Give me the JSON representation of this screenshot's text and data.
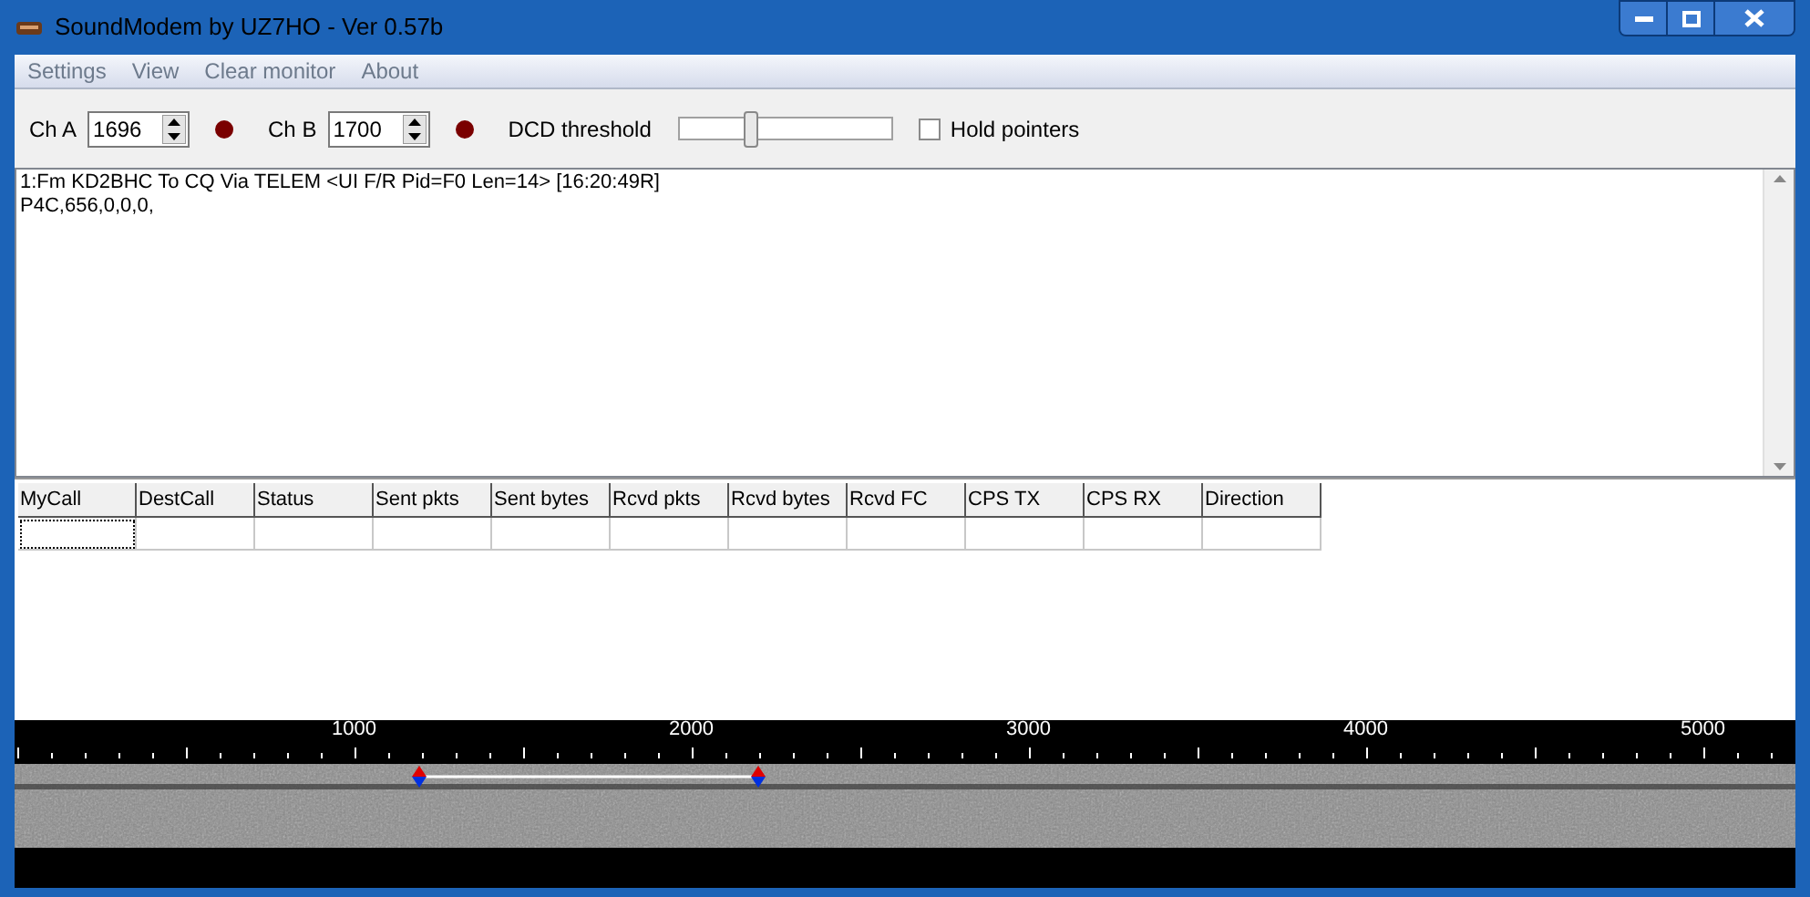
{
  "window": {
    "title": "SoundModem by UZ7HO - Ver 0.57b"
  },
  "menu": [
    "Settings",
    "View",
    "Clear monitor",
    "About"
  ],
  "toolbar": {
    "channels": [
      {
        "label": "Ch A",
        "value": "1696",
        "color": "#7a0000"
      },
      {
        "label": "Ch B",
        "value": "1700",
        "color": "#7a0000"
      }
    ],
    "dcd": {
      "label": "DCD threshold",
      "level": 0.32
    },
    "hold_pointers": {
      "label": "Hold pointers",
      "checked": false
    }
  },
  "monitor": {
    "lines": [
      "1:Fm KD2BHC To CQ Via TELEM <UI F/R Pid=F0 Len=14> [16:20:49R]",
      "P4C,656,0,0,0,"
    ]
  },
  "table": {
    "columns": [
      "MyCall",
      "DestCall",
      "Status",
      "Sent pkts",
      "Sent bytes",
      "Rcvd pkts",
      "Rcvd bytes",
      "Rcvd FC",
      "CPS TX",
      "CPS RX",
      "Direction"
    ]
  },
  "waterfall": {
    "scale_labels": [
      "1000",
      "2000",
      "3000",
      "4000",
      "5000"
    ]
  }
}
